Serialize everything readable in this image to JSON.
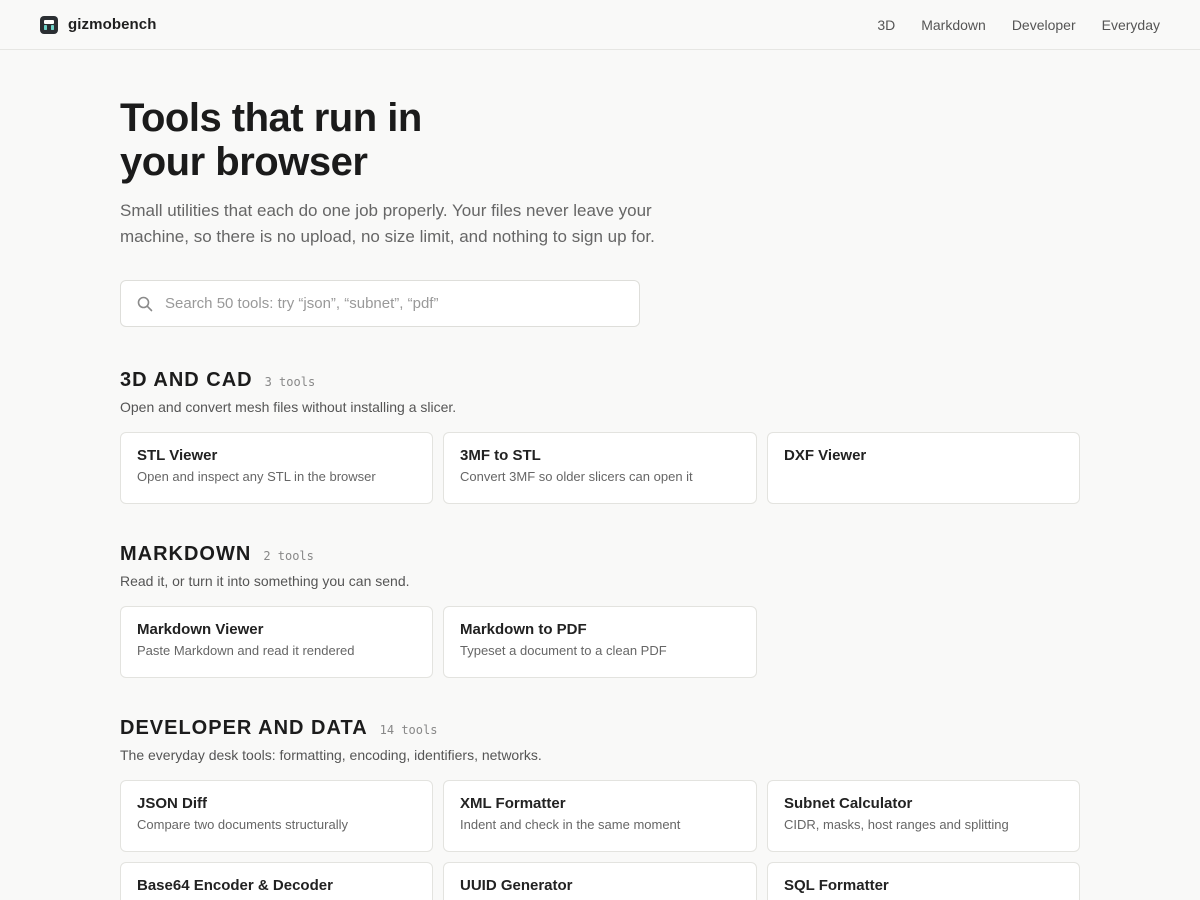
{
  "brand": {
    "name": "gizmobench"
  },
  "nav": {
    "items": [
      {
        "label": "3D"
      },
      {
        "label": "Markdown"
      },
      {
        "label": "Developer"
      },
      {
        "label": "Everyday"
      }
    ]
  },
  "hero": {
    "title_line1": "Tools that run in",
    "title_line2": "your browser",
    "subtitle": "Small utilities that each do one job properly. Your files never leave your machine, so there is no upload, no size limit, and nothing to sign up for."
  },
  "search": {
    "placeholder": "Search 50 tools: try “json”, “subnet”, “pdf”",
    "value": ""
  },
  "sections": [
    {
      "title": "3D AND CAD",
      "count": "3 tools",
      "description": "Open and convert mesh files without installing a slicer.",
      "tools": [
        {
          "title": "STL Viewer",
          "description": "Open and inspect any STL in the browser"
        },
        {
          "title": "3MF to STL",
          "description": "Convert 3MF so older slicers can open it"
        },
        {
          "title": "DXF Viewer",
          "description": ""
        }
      ]
    },
    {
      "title": "MARKDOWN",
      "count": "2 tools",
      "description": "Read it, or turn it into something you can send.",
      "tools": [
        {
          "title": "Markdown Viewer",
          "description": "Paste Markdown and read it rendered"
        },
        {
          "title": "Markdown to PDF",
          "description": "Typeset a document to a clean PDF"
        }
      ]
    },
    {
      "title": "DEVELOPER AND DATA",
      "count": "14 tools",
      "description": "The everyday desk tools: formatting, encoding, identifiers, networks.",
      "tools": [
        {
          "title": "JSON Diff",
          "description": "Compare two documents structurally"
        },
        {
          "title": "XML Formatter",
          "description": "Indent and check in the same moment"
        },
        {
          "title": "Subnet Calculator",
          "description": "CIDR, masks, host ranges and splitting"
        },
        {
          "title": "Base64 Encoder & Decoder",
          "description": ""
        },
        {
          "title": "UUID Generator",
          "description": ""
        },
        {
          "title": "SQL Formatter",
          "description": ""
        }
      ]
    }
  ],
  "colors": {
    "background": "#f9f9f8",
    "card": "#ffffff",
    "border": "#e3e3df",
    "text": "#1a1a1a",
    "muted": "#666666"
  }
}
